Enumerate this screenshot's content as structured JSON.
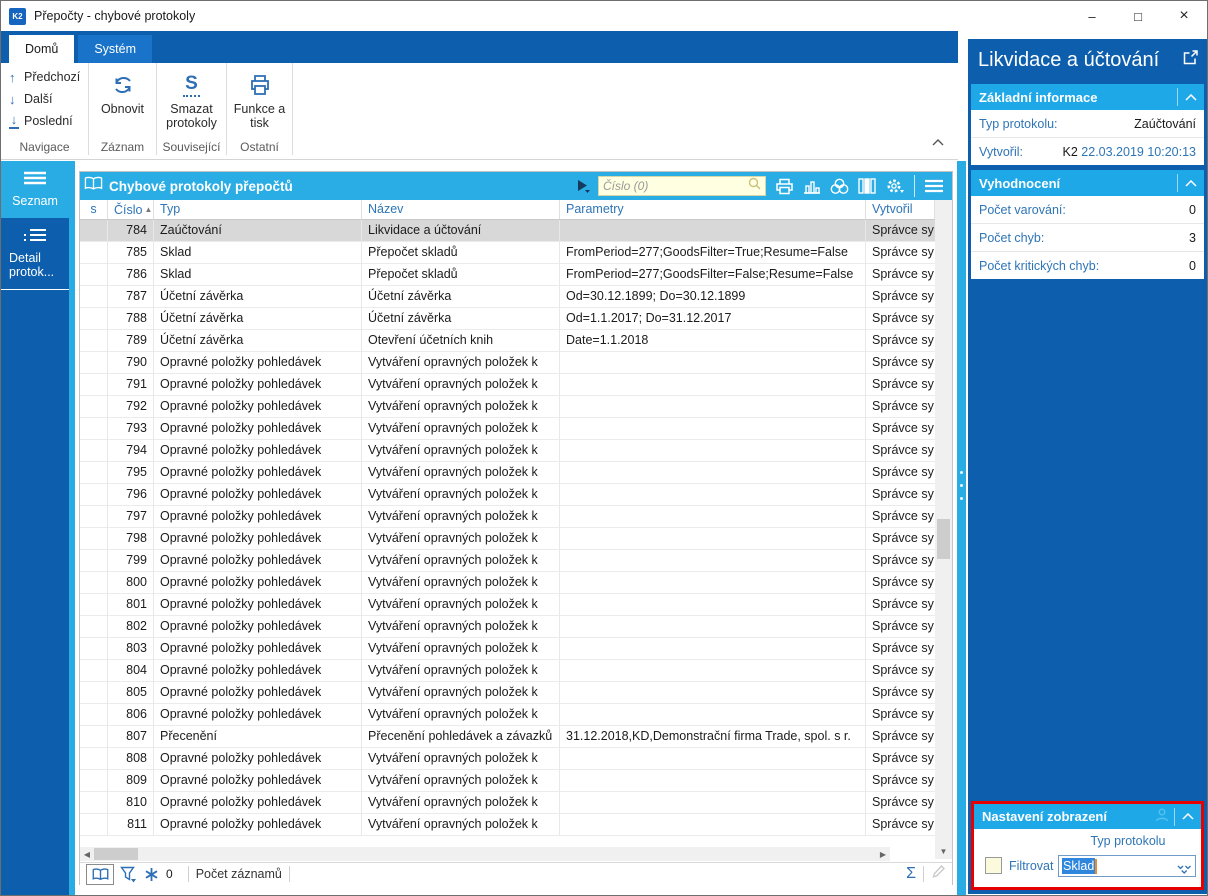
{
  "window": {
    "title": "Přepočty - chybové protokoly",
    "app_icon_label": "K2",
    "controls": {
      "minimize": "–",
      "maximize": "□",
      "close": "×"
    }
  },
  "ribbon": {
    "tabs": [
      {
        "label": "Domů",
        "active": true
      },
      {
        "label": "Systém",
        "active": false
      }
    ],
    "groups": [
      {
        "label": "Navigace",
        "buttons": [
          {
            "label": "Předchozí"
          },
          {
            "label": "Další"
          },
          {
            "label": "Poslední"
          }
        ]
      },
      {
        "label": "Záznam",
        "buttons": [
          {
            "label": "Obnovit"
          }
        ]
      },
      {
        "label": "Související",
        "buttons": [
          {
            "label": "Smazat protokoly"
          }
        ]
      },
      {
        "label": "Ostatní",
        "buttons": [
          {
            "label": "Funkce a tisk"
          }
        ]
      }
    ]
  },
  "sidebar": {
    "items": [
      {
        "label": "Seznam",
        "active": true
      },
      {
        "label": "Detail protok...",
        "active": false
      }
    ]
  },
  "table": {
    "title": "Chybové protokoly přepočtů",
    "search_placeholder": "Číslo (0)",
    "columns": [
      "s",
      "Číslo",
      "Typ",
      "Název",
      "Parametry",
      "Vytvořil"
    ],
    "sort_column": "Číslo",
    "rows": [
      {
        "cislo": "784",
        "typ": "Zaúčtování",
        "nazev": "Likvidace a účtování",
        "parametry": "",
        "vytvoril": "Správce sy",
        "selected": true
      },
      {
        "cislo": "785",
        "typ": "Sklad",
        "nazev": "Přepočet skladů",
        "parametry": "FromPeriod=277;GoodsFilter=True;Resume=False",
        "vytvoril": "Správce sy"
      },
      {
        "cislo": "786",
        "typ": "Sklad",
        "nazev": "Přepočet skladů",
        "parametry": "FromPeriod=277;GoodsFilter=False;Resume=False",
        "vytvoril": "Správce sy"
      },
      {
        "cislo": "787",
        "typ": "Účetní závěrka",
        "nazev": "Účetní závěrka",
        "parametry": "Od=30.12.1899; Do=30.12.1899",
        "vytvoril": "Správce sy"
      },
      {
        "cislo": "788",
        "typ": "Účetní závěrka",
        "nazev": "Účetní závěrka",
        "parametry": "Od=1.1.2017; Do=31.12.2017",
        "vytvoril": "Správce sy"
      },
      {
        "cislo": "789",
        "typ": "Účetní závěrka",
        "nazev": "Otevření účetních knih",
        "parametry": "Date=1.1.2018",
        "vytvoril": "Správce sy"
      },
      {
        "cislo": "790",
        "typ": "Opravné položky pohledávek",
        "nazev": "Vytváření opravných položek k",
        "parametry": "",
        "vytvoril": "Správce sy"
      },
      {
        "cislo": "791",
        "typ": "Opravné položky pohledávek",
        "nazev": "Vytváření opravných položek k",
        "parametry": "",
        "vytvoril": "Správce sy"
      },
      {
        "cislo": "792",
        "typ": "Opravné položky pohledávek",
        "nazev": "Vytváření opravných položek k",
        "parametry": "",
        "vytvoril": "Správce sy"
      },
      {
        "cislo": "793",
        "typ": "Opravné položky pohledávek",
        "nazev": "Vytváření opravných položek k",
        "parametry": "",
        "vytvoril": "Správce sy"
      },
      {
        "cislo": "794",
        "typ": "Opravné položky pohledávek",
        "nazev": "Vytváření opravných položek k",
        "parametry": "",
        "vytvoril": "Správce sy"
      },
      {
        "cislo": "795",
        "typ": "Opravné položky pohledávek",
        "nazev": "Vytváření opravných položek k",
        "parametry": "",
        "vytvoril": "Správce sy"
      },
      {
        "cislo": "796",
        "typ": "Opravné položky pohledávek",
        "nazev": "Vytváření opravných položek k",
        "parametry": "",
        "vytvoril": "Správce sy"
      },
      {
        "cislo": "797",
        "typ": "Opravné položky pohledávek",
        "nazev": "Vytváření opravných položek k",
        "parametry": "",
        "vytvoril": "Správce sy"
      },
      {
        "cislo": "798",
        "typ": "Opravné položky pohledávek",
        "nazev": "Vytváření opravných položek k",
        "parametry": "",
        "vytvoril": "Správce sy"
      },
      {
        "cislo": "799",
        "typ": "Opravné položky pohledávek",
        "nazev": "Vytváření opravných položek k",
        "parametry": "",
        "vytvoril": "Správce sy"
      },
      {
        "cislo": "800",
        "typ": "Opravné položky pohledávek",
        "nazev": "Vytváření opravných položek k",
        "parametry": "",
        "vytvoril": "Správce sy"
      },
      {
        "cislo": "801",
        "typ": "Opravné položky pohledávek",
        "nazev": "Vytváření opravných položek k",
        "parametry": "",
        "vytvoril": "Správce sy"
      },
      {
        "cislo": "802",
        "typ": "Opravné položky pohledávek",
        "nazev": "Vytváření opravných položek k",
        "parametry": "",
        "vytvoril": "Správce sy"
      },
      {
        "cislo": "803",
        "typ": "Opravné položky pohledávek",
        "nazev": "Vytváření opravných položek k",
        "parametry": "",
        "vytvoril": "Správce sy"
      },
      {
        "cislo": "804",
        "typ": "Opravné položky pohledávek",
        "nazev": "Vytváření opravných položek k",
        "parametry": "",
        "vytvoril": "Správce sy"
      },
      {
        "cislo": "805",
        "typ": "Opravné položky pohledávek",
        "nazev": "Vytváření opravných položek k",
        "parametry": "",
        "vytvoril": "Správce sy"
      },
      {
        "cislo": "806",
        "typ": "Opravné položky pohledávek",
        "nazev": "Vytváření opravných položek k",
        "parametry": "",
        "vytvoril": "Správce sy"
      },
      {
        "cislo": "807",
        "typ": "Přecenění",
        "nazev": "Přecenění pohledávek a závazků",
        "parametry": "31.12.2018,KD,Demonstrační firma Trade, spol. s r.",
        "vytvoril": "Správce sy"
      },
      {
        "cislo": "808",
        "typ": "Opravné položky pohledávek",
        "nazev": "Vytváření opravných položek k",
        "parametry": "",
        "vytvoril": "Správce sy"
      },
      {
        "cislo": "809",
        "typ": "Opravné položky pohledávek",
        "nazev": "Vytváření opravných položek k",
        "parametry": "",
        "vytvoril": "Správce sy"
      },
      {
        "cislo": "810",
        "typ": "Opravné položky pohledávek",
        "nazev": "Vytváření opravných položek k",
        "parametry": "",
        "vytvoril": "Správce sy"
      },
      {
        "cislo": "811",
        "typ": "Opravné položky pohledávek",
        "nazev": "Vytváření opravných položek k",
        "parametry": "",
        "vytvoril": "Správce sy"
      }
    ],
    "status": {
      "frozen_count": "0",
      "records_label": "Počet záznamů"
    }
  },
  "panel": {
    "title": "Likvidace a účtování",
    "sections": [
      {
        "title": "Základní informace",
        "rows": [
          {
            "label": "Typ protokolu:",
            "value": "Zaúčtování"
          },
          {
            "label": "Vytvořil:",
            "value_prefix": "K2 ",
            "value": "22.03.2019 10:20:13"
          }
        ]
      },
      {
        "title": "Vyhodnocení",
        "rows": [
          {
            "label": "Počet varování:",
            "value": "0"
          },
          {
            "label": "Počet chyb:",
            "value": "3"
          },
          {
            "label": "Počet kritických chyb:",
            "value": "0"
          }
        ]
      }
    ],
    "settings": {
      "title": "Nastavení zobrazení",
      "field_label": "Typ protokolu",
      "checkbox_label": "Filtrovat",
      "filter_value": "Sklad",
      "checkbox_checked": false
    }
  },
  "colors": {
    "dark_blue": "#0d5fae",
    "cyan": "#29ade4",
    "section_cyan": "#1fa8e8",
    "label_blue": "#2e75b6",
    "highlight_red": "#e60000",
    "selection_blue": "#2f86dd",
    "search_yellow": "#ffffe1",
    "selected_row_gray": "#d8d8d8"
  }
}
